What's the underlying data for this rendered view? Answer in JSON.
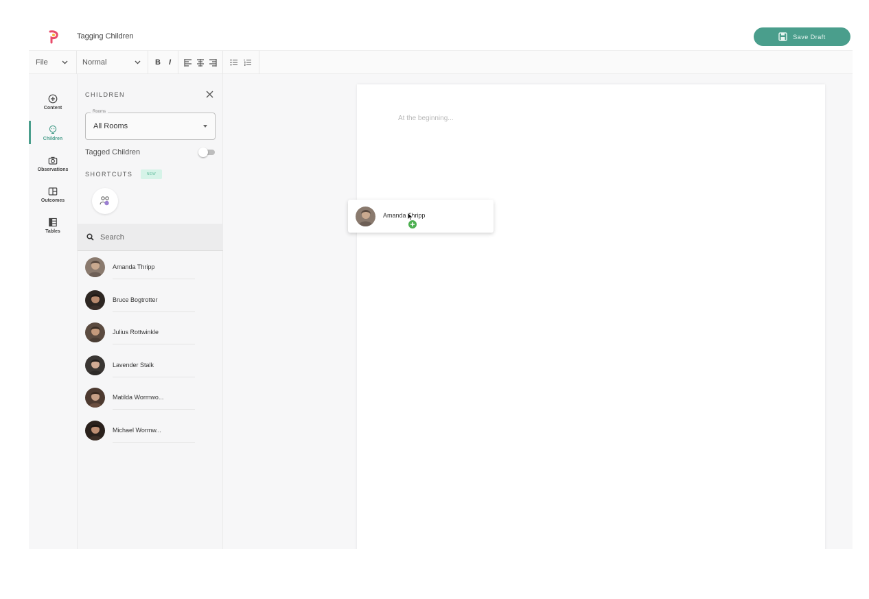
{
  "app": {
    "title": "Tagging Children",
    "save_label": "Save Draft",
    "accent_color": "#4a9e8c"
  },
  "toolbar": {
    "file_label": "File",
    "style_label": "Normal",
    "bold_label": "B",
    "italic_label": "I"
  },
  "rail": {
    "items": [
      {
        "label": "Content",
        "icon": "plus-circle-icon"
      },
      {
        "label": "Children",
        "icon": "children-icon",
        "active": true
      },
      {
        "label": "Observations",
        "icon": "camera-icon"
      },
      {
        "label": "Outcomes",
        "icon": "outcomes-icon"
      },
      {
        "label": "Tables",
        "icon": "table-icon"
      }
    ]
  },
  "panel": {
    "heading": "CHILDREN",
    "rooms_legend": "Rooms",
    "rooms_value": "All Rooms",
    "tagged_label": "Tagged Children",
    "tagged_on": false,
    "shortcuts_label": "SHORTCUTS",
    "new_badge": "NEW",
    "search_placeholder": "Search",
    "children": [
      {
        "name": "Amanda Thripp"
      },
      {
        "name": "Bruce Bogtrotter"
      },
      {
        "name": "Julius Rottwinkle"
      },
      {
        "name": "Lavender Stalk"
      },
      {
        "name": "Matilda Wormwo..."
      },
      {
        "name": "Michael Wormw..."
      }
    ]
  },
  "editor": {
    "placeholder": "At the beginning..."
  },
  "drag_chip": {
    "name": "Amanda Thripp"
  }
}
